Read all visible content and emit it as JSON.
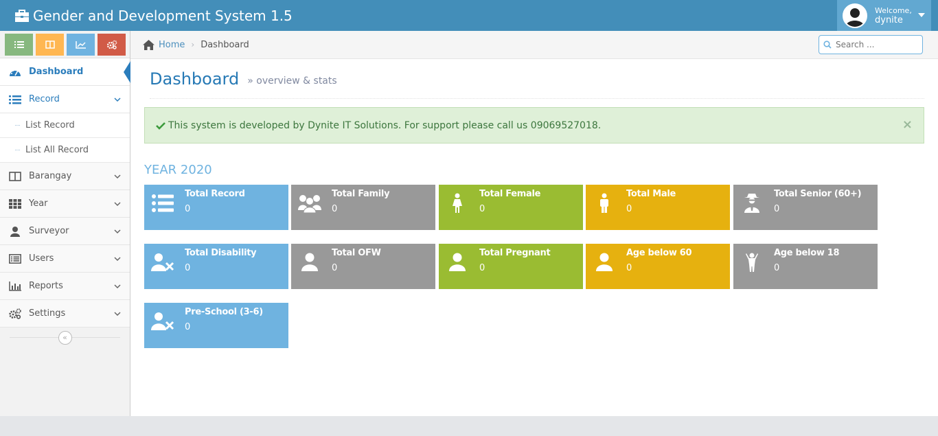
{
  "app": {
    "title": "Gender and Development System 1.5"
  },
  "user": {
    "welcome": "Welcome,",
    "name": "dynite"
  },
  "shortcuts": [
    {
      "icon": "list-icon",
      "color": "#87b87f"
    },
    {
      "icon": "columns-icon",
      "color": "#ffb752"
    },
    {
      "icon": "chart-icon",
      "color": "#6fb3e0"
    },
    {
      "icon": "cogs-icon",
      "color": "#d15b47"
    }
  ],
  "sidebar": {
    "items": [
      {
        "label": "Dashboard",
        "icon": "tachometer-icon"
      },
      {
        "label": "Record",
        "icon": "list-icon"
      },
      {
        "label": "Barangay",
        "icon": "columns-icon"
      },
      {
        "label": "Year",
        "icon": "grid-icon"
      },
      {
        "label": "Surveyor",
        "icon": "user-icon"
      },
      {
        "label": "Users",
        "icon": "list-alt-icon"
      },
      {
        "label": "Reports",
        "icon": "bar-chart-icon"
      },
      {
        "label": "Settings",
        "icon": "cogs-icon"
      }
    ],
    "record_submenu": [
      "List Record",
      "List All Record"
    ]
  },
  "breadcrumb": {
    "home": "Home",
    "current": "Dashboard"
  },
  "search": {
    "placeholder": "Search ..."
  },
  "page": {
    "title": "Dashboard",
    "subtitle": "overview & stats"
  },
  "alert": {
    "text": "This system is developed by Dynite IT Solutions. For support please call us 09069527018.",
    "close": "×"
  },
  "year_label": "YEAR 2020",
  "tiles": [
    {
      "label": "Total Record",
      "value": "0",
      "color": "#6fb3e0",
      "icon": "list-icon"
    },
    {
      "label": "Total Family",
      "value": "0",
      "color": "#999999",
      "icon": "users-icon"
    },
    {
      "label": "Total Female",
      "value": "0",
      "color": "#9abc32",
      "icon": "female-icon"
    },
    {
      "label": "Total Male",
      "value": "0",
      "color": "#e6b10f",
      "icon": "male-icon"
    },
    {
      "label": "Total Senior (60+)",
      "value": "0",
      "color": "#999999",
      "icon": "user-secret-icon"
    },
    {
      "label": "Total Disability",
      "value": "0",
      "color": "#6fb3e0",
      "icon": "user-times-icon"
    },
    {
      "label": "Total OFW",
      "value": "0",
      "color": "#999999",
      "icon": "user-icon"
    },
    {
      "label": "Total Pregnant",
      "value": "0",
      "color": "#9abc32",
      "icon": "user-icon"
    },
    {
      "label": "Age below 60",
      "value": "0",
      "color": "#e6b10f",
      "icon": "user-icon"
    },
    {
      "label": "Age below 18",
      "value": "0",
      "color": "#999999",
      "icon": "child-icon"
    },
    {
      "label": "Pre-School (3-6)",
      "value": "0",
      "color": "#6fb3e0",
      "icon": "user-times-icon"
    }
  ]
}
